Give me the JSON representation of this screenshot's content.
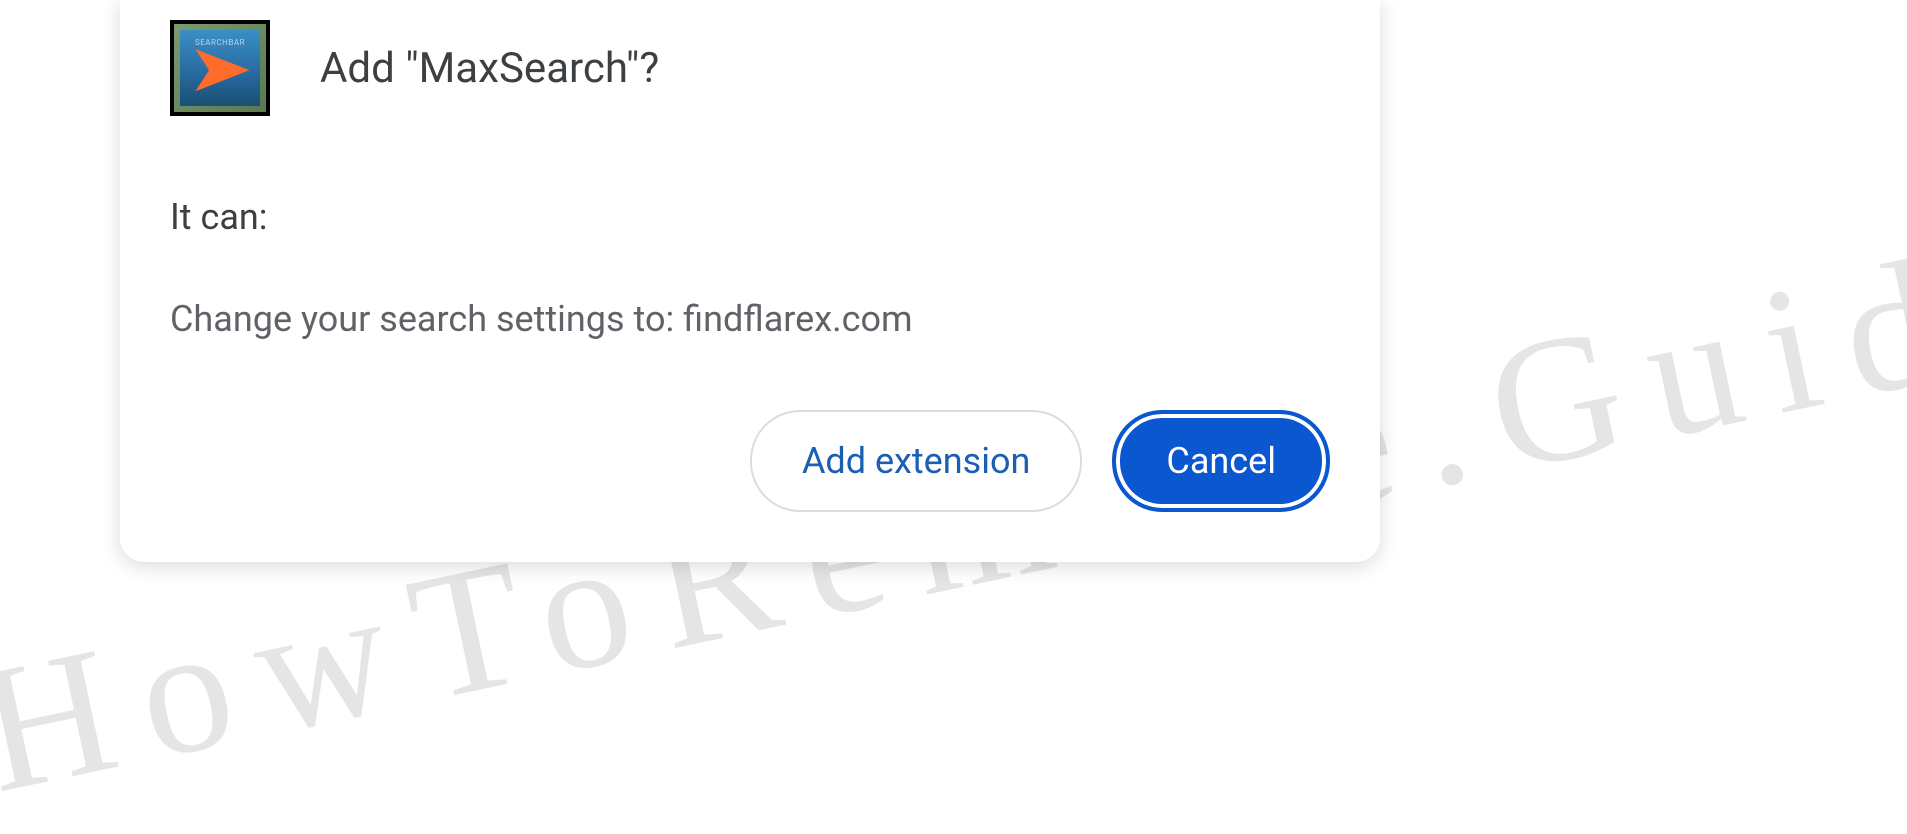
{
  "watermark": "HowToRemove.Guide",
  "dialog": {
    "title": "Add \"MaxSearch\"?",
    "extension_name": "MaxSearch",
    "permissions_heading": "It can:",
    "permissions": [
      "Change your search settings to: findflarex.com"
    ],
    "actions": {
      "confirm_label": "Add extension",
      "cancel_label": "Cancel"
    }
  }
}
